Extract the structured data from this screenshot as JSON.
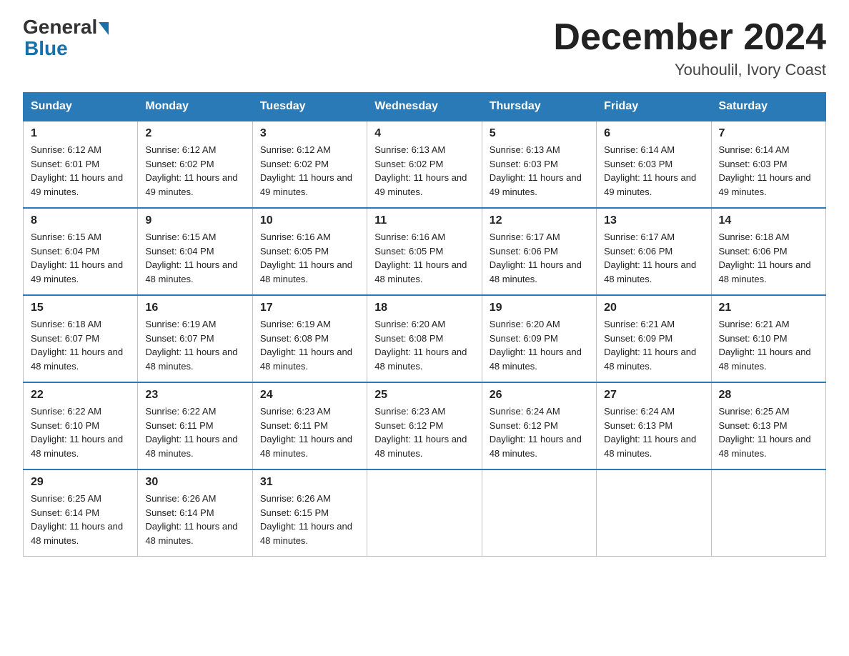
{
  "header": {
    "logo_general": "General",
    "logo_blue": "Blue",
    "title": "December 2024",
    "location": "Youhoulil, Ivory Coast"
  },
  "columns": [
    "Sunday",
    "Monday",
    "Tuesday",
    "Wednesday",
    "Thursday",
    "Friday",
    "Saturday"
  ],
  "weeks": [
    [
      {
        "day": "1",
        "sunrise": "6:12 AM",
        "sunset": "6:01 PM",
        "daylight": "11 hours and 49 minutes."
      },
      {
        "day": "2",
        "sunrise": "6:12 AM",
        "sunset": "6:02 PM",
        "daylight": "11 hours and 49 minutes."
      },
      {
        "day": "3",
        "sunrise": "6:12 AM",
        "sunset": "6:02 PM",
        "daylight": "11 hours and 49 minutes."
      },
      {
        "day": "4",
        "sunrise": "6:13 AM",
        "sunset": "6:02 PM",
        "daylight": "11 hours and 49 minutes."
      },
      {
        "day": "5",
        "sunrise": "6:13 AM",
        "sunset": "6:03 PM",
        "daylight": "11 hours and 49 minutes."
      },
      {
        "day": "6",
        "sunrise": "6:14 AM",
        "sunset": "6:03 PM",
        "daylight": "11 hours and 49 minutes."
      },
      {
        "day": "7",
        "sunrise": "6:14 AM",
        "sunset": "6:03 PM",
        "daylight": "11 hours and 49 minutes."
      }
    ],
    [
      {
        "day": "8",
        "sunrise": "6:15 AM",
        "sunset": "6:04 PM",
        "daylight": "11 hours and 49 minutes."
      },
      {
        "day": "9",
        "sunrise": "6:15 AM",
        "sunset": "6:04 PM",
        "daylight": "11 hours and 48 minutes."
      },
      {
        "day": "10",
        "sunrise": "6:16 AM",
        "sunset": "6:05 PM",
        "daylight": "11 hours and 48 minutes."
      },
      {
        "day": "11",
        "sunrise": "6:16 AM",
        "sunset": "6:05 PM",
        "daylight": "11 hours and 48 minutes."
      },
      {
        "day": "12",
        "sunrise": "6:17 AM",
        "sunset": "6:06 PM",
        "daylight": "11 hours and 48 minutes."
      },
      {
        "day": "13",
        "sunrise": "6:17 AM",
        "sunset": "6:06 PM",
        "daylight": "11 hours and 48 minutes."
      },
      {
        "day": "14",
        "sunrise": "6:18 AM",
        "sunset": "6:06 PM",
        "daylight": "11 hours and 48 minutes."
      }
    ],
    [
      {
        "day": "15",
        "sunrise": "6:18 AM",
        "sunset": "6:07 PM",
        "daylight": "11 hours and 48 minutes."
      },
      {
        "day": "16",
        "sunrise": "6:19 AM",
        "sunset": "6:07 PM",
        "daylight": "11 hours and 48 minutes."
      },
      {
        "day": "17",
        "sunrise": "6:19 AM",
        "sunset": "6:08 PM",
        "daylight": "11 hours and 48 minutes."
      },
      {
        "day": "18",
        "sunrise": "6:20 AM",
        "sunset": "6:08 PM",
        "daylight": "11 hours and 48 minutes."
      },
      {
        "day": "19",
        "sunrise": "6:20 AM",
        "sunset": "6:09 PM",
        "daylight": "11 hours and 48 minutes."
      },
      {
        "day": "20",
        "sunrise": "6:21 AM",
        "sunset": "6:09 PM",
        "daylight": "11 hours and 48 minutes."
      },
      {
        "day": "21",
        "sunrise": "6:21 AM",
        "sunset": "6:10 PM",
        "daylight": "11 hours and 48 minutes."
      }
    ],
    [
      {
        "day": "22",
        "sunrise": "6:22 AM",
        "sunset": "6:10 PM",
        "daylight": "11 hours and 48 minutes."
      },
      {
        "day": "23",
        "sunrise": "6:22 AM",
        "sunset": "6:11 PM",
        "daylight": "11 hours and 48 minutes."
      },
      {
        "day": "24",
        "sunrise": "6:23 AM",
        "sunset": "6:11 PM",
        "daylight": "11 hours and 48 minutes."
      },
      {
        "day": "25",
        "sunrise": "6:23 AM",
        "sunset": "6:12 PM",
        "daylight": "11 hours and 48 minutes."
      },
      {
        "day": "26",
        "sunrise": "6:24 AM",
        "sunset": "6:12 PM",
        "daylight": "11 hours and 48 minutes."
      },
      {
        "day": "27",
        "sunrise": "6:24 AM",
        "sunset": "6:13 PM",
        "daylight": "11 hours and 48 minutes."
      },
      {
        "day": "28",
        "sunrise": "6:25 AM",
        "sunset": "6:13 PM",
        "daylight": "11 hours and 48 minutes."
      }
    ],
    [
      {
        "day": "29",
        "sunrise": "6:25 AM",
        "sunset": "6:14 PM",
        "daylight": "11 hours and 48 minutes."
      },
      {
        "day": "30",
        "sunrise": "6:26 AM",
        "sunset": "6:14 PM",
        "daylight": "11 hours and 48 minutes."
      },
      {
        "day": "31",
        "sunrise": "6:26 AM",
        "sunset": "6:15 PM",
        "daylight": "11 hours and 48 minutes."
      },
      null,
      null,
      null,
      null
    ]
  ]
}
